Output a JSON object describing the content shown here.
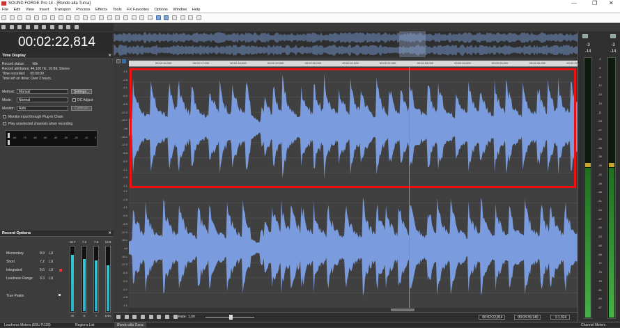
{
  "window": {
    "title": "SOUND FORGE Pro 14 - [Rondo alla Turca]",
    "controls": [
      "—",
      "❐",
      "✕"
    ]
  },
  "menu": [
    "File",
    "Edit",
    "View",
    "Insert",
    "Transport",
    "Process",
    "Effects",
    "Tools",
    "FX Favorites",
    "Options",
    "Window",
    "Help"
  ],
  "time_display": {
    "big_time": "00:02:22,814",
    "panel_title": "Time Display",
    "status_rows": [
      {
        "label": "Record status:",
        "value": "Idle"
      },
      {
        "label": "Record attributes:",
        "value": "44.100 Hz; 16 Bit; Stereo"
      },
      {
        "label": "Time recorded:",
        "value": "00:00:00"
      },
      {
        "label": "Time left on drive:",
        "value": "Over 2 hours."
      }
    ],
    "method_label": "Method:",
    "method_value": "Manual",
    "settings_button": "Settings...",
    "mode_label": "Mode:",
    "mode_value": "Normal",
    "dc_adjust_label": "DC Adjust",
    "monitor_label": "Monitor:",
    "monitor_value": "Auto",
    "calibrate_button": "Calibrate",
    "monitor_plugin_label": "Monitor input through Plug-in Chain",
    "play_unselected_label": "Play unselected channels when recording",
    "level_scale": [
      "-Inf",
      "-70",
      "-60",
      "-50",
      "-40",
      "-30",
      "-20",
      "-10",
      "0"
    ]
  },
  "record_options": {
    "panel_title": "Record Options",
    "rows": [
      {
        "label": "Momentary",
        "value": "8.9",
        "unit": "LU"
      },
      {
        "label": "Short",
        "value": "7.2",
        "unit": "LU"
      },
      {
        "label": "Integrated",
        "value": "6.6",
        "unit": "LU"
      },
      {
        "label": "Loudness Range",
        "value": "9.3",
        "unit": "LU"
      }
    ],
    "true_peaks_label": "True Peaks",
    "meter_tops": [
      "18.7",
      "7.2",
      "7.6",
      "13.6"
    ],
    "meter_bottoms": [
      "M",
      "S",
      "I",
      "LRA"
    ],
    "meter_levels": [
      0.86,
      0.8,
      0.78,
      0.7
    ]
  },
  "bottom_tabs": [
    "Loudness Meters (EBU R128)",
    "Regions List",
    "Rondo alla Turca",
    "Channel Meters"
  ],
  "ruler": {
    "ticks": [
      "00:02:16,000",
      "00:02:17,000",
      "00:02:18,000",
      "00:02:19,000",
      "00:02:20,000",
      "00:02:21,000",
      "00:02:22,000",
      "00:02:23,000",
      "00:02:24,000",
      "00:02:25,000",
      "00:02:26,000",
      "00:02:27,000"
    ]
  },
  "db_scale": [
    "-1.1",
    "-2.5",
    "-4.1",
    "-6.0",
    "-8.5",
    "-12.0",
    "-18.1",
    "-Inf",
    "-18.1",
    "-12.0",
    "-8.5",
    "-6.0",
    "-4.1",
    "-2.5",
    "-1.1"
  ],
  "transport": {
    "rate_label": "Rate:",
    "rate_value": "1,00",
    "position": "00:02:22,814",
    "length": "00:03:39,140",
    "zoom": "1:1.024"
  },
  "channel_meters": {
    "peak_top": [
      "-3",
      "-3"
    ],
    "peak_low": [
      "-14",
      "-14"
    ],
    "scale": [
      "-3",
      "-6",
      "-9",
      "-12",
      "-15",
      "-18",
      "-21",
      "-24",
      "-27",
      "-30",
      "-33",
      "-36",
      "-39",
      "-42",
      "-45",
      "-48",
      "-51",
      "-54",
      "-57",
      "-60",
      "-63",
      "-66",
      "-69",
      "-72",
      "-75",
      "-78",
      "-81",
      "-84",
      "-87"
    ],
    "levels": [
      0.58,
      0.58
    ]
  },
  "colors": {
    "waveform": "#7a9cde",
    "waveform_bg": "#404040",
    "highlight_box": "#ee1111",
    "loudness_meter": "#35c8d6",
    "channel_meter": "#46b046"
  }
}
